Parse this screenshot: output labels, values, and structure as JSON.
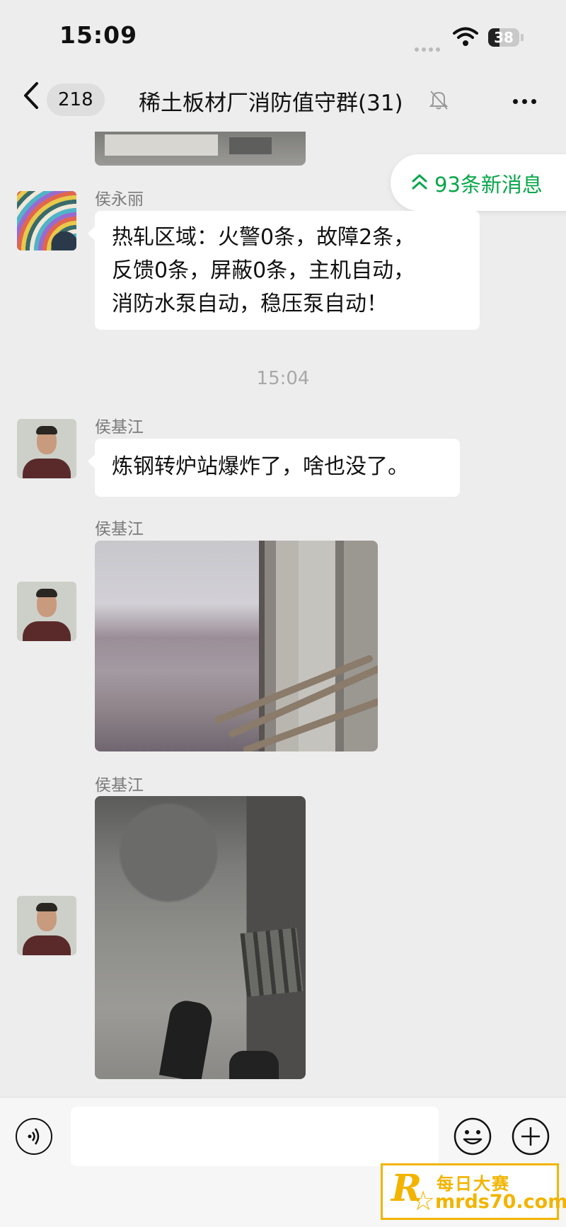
{
  "status_bar": {
    "time": "15:09",
    "battery": "38"
  },
  "nav": {
    "unread_count": "218",
    "title": "稀土板材厂消防值守群(31)"
  },
  "new_messages": {
    "label": "93条新消息"
  },
  "messages": [
    {
      "sender": "侯永丽",
      "lines": [
        "热轧区域：火警0条，故障2条，",
        "反馈0条，屏蔽0条，主机自动，",
        "消防水泵自动，稳压泵自动！"
      ]
    },
    {
      "sender": "侯基江",
      "text": "炼钢转炉站爆炸了，啥也没了。"
    },
    {
      "sender": "侯基江",
      "type": "image"
    },
    {
      "sender": "侯基江",
      "type": "image"
    }
  ],
  "time_divider": "15:04",
  "input": {
    "value": "",
    "placeholder": ""
  },
  "watermark": {
    "brand_cn": "每日大赛",
    "domain": "mrds70.com",
    "letter": "R"
  },
  "colors": {
    "accent_green": "#07a74a",
    "background": "#ededed",
    "watermark": "#f2b400"
  }
}
